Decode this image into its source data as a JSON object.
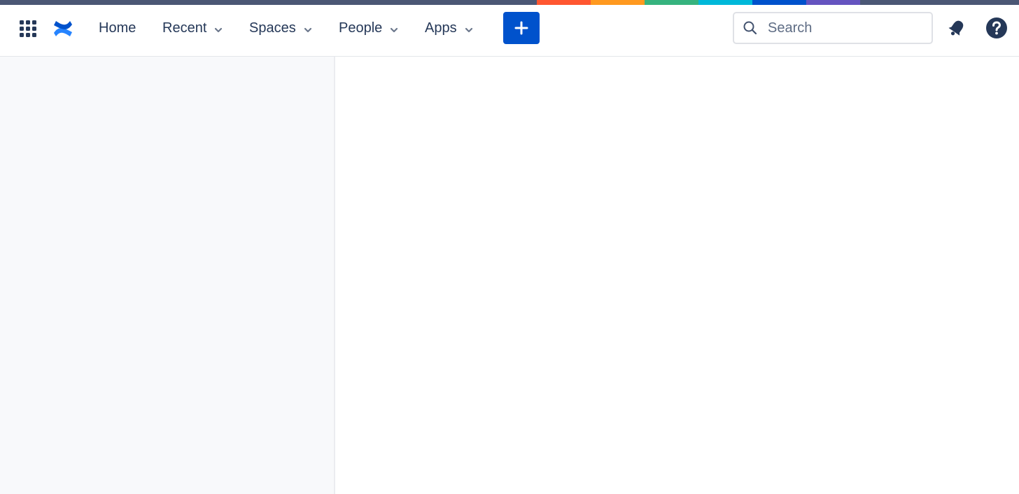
{
  "stripe": {
    "base_color": "#4b5775",
    "colors": [
      "#ff5630",
      "#ff991f",
      "#36b37e",
      "#00b8d9",
      "#0052cc",
      "#6554c0"
    ]
  },
  "nav": {
    "app_switcher_icon": "app-switcher-grid-icon",
    "logo_icon": "confluence-logo-icon",
    "items": [
      {
        "label": "Home",
        "has_dropdown": false
      },
      {
        "label": "Recent",
        "has_dropdown": true
      },
      {
        "label": "Spaces",
        "has_dropdown": true
      },
      {
        "label": "People",
        "has_dropdown": true
      },
      {
        "label": "Apps",
        "has_dropdown": true
      }
    ],
    "create_icon": "plus-icon",
    "create_color": "#0052cc"
  },
  "search": {
    "placeholder": "Search",
    "value": "",
    "icon": "search-icon"
  },
  "actions": {
    "notifications_icon": "bell-icon",
    "help_icon": "help-icon"
  },
  "colors": {
    "text_primary": "#253858",
    "sidebar_bg": "#f8f9fb",
    "main_bg": "#ffffff"
  }
}
